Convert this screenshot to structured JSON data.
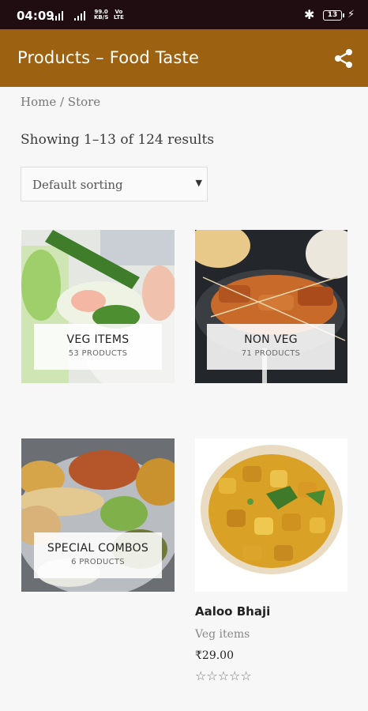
{
  "status_bar": {
    "time": "04:09",
    "net_rate_value": "99.0",
    "net_rate_unit": "KB/S",
    "volte_top": "Vo",
    "volte_bottom": "LTE",
    "bluetooth_icon": "bluetooth-icon",
    "battery": "13",
    "charging_icon": "bolt-icon"
  },
  "app_bar": {
    "title": "Products – Food Taste",
    "share_icon": "share-icon",
    "color": "#9c6111"
  },
  "breadcrumb": "Home / Store",
  "results_text": "Showing 1–13 of 124 results",
  "sort": {
    "selected": "Default sorting",
    "caret_icon": "triangle-down-icon"
  },
  "categories": [
    {
      "name": "VEG ITEMS",
      "count": "53 PRODUCTS"
    },
    {
      "name": "NON VEG",
      "count": "71 PRODUCTS"
    },
    {
      "name": "SPECIAL COMBOS",
      "count": "6 PRODUCTS"
    }
  ],
  "product": {
    "name": "Aaloo Bhaji",
    "category": "Veg items",
    "price": "₹29.00",
    "rating_stars": "☆☆☆☆☆",
    "rating": 0
  }
}
